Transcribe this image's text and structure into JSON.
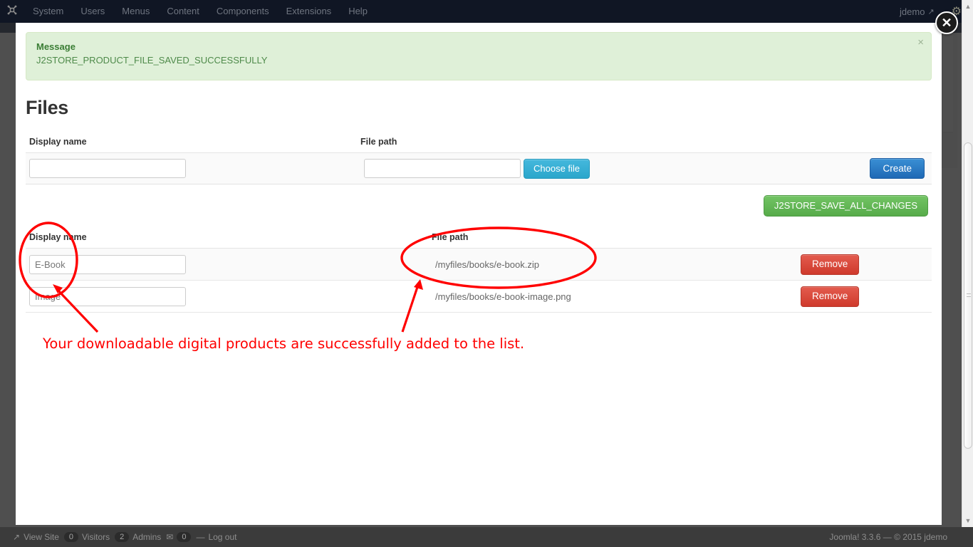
{
  "admin_bar": {
    "logo_icon": "joomla-logo-icon",
    "menu": [
      {
        "label": "System"
      },
      {
        "label": "Users"
      },
      {
        "label": "Menus"
      },
      {
        "label": "Content"
      },
      {
        "label": "Components"
      },
      {
        "label": "Extensions"
      },
      {
        "label": "Help"
      }
    ],
    "user": "jdemo",
    "external_link_icon": "external-link-icon",
    "gear_icon": "gear-icon"
  },
  "modal": {
    "close_icon": "close-icon",
    "close_label": "✕"
  },
  "alert": {
    "title": "Message",
    "text": "J2STORE_PRODUCT_FILE_SAVED_SUCCESSFULLY",
    "close_label": "×",
    "bg_color": "#dff0d8",
    "text_color": "#4e8a4a"
  },
  "page": {
    "title": "Files"
  },
  "create_form": {
    "headers": {
      "display_name": "Display name",
      "file_path": "File path"
    },
    "display_name_value": "",
    "display_name_placeholder": "",
    "file_path_value": "",
    "file_path_placeholder": "",
    "choose_file_label": "Choose file",
    "create_label": "Create"
  },
  "save_all": {
    "label": "J2STORE_SAVE_ALL_CHANGES",
    "color": "#5cb85c"
  },
  "file_list": {
    "headers": {
      "display_name": "Display name",
      "file_path": "File path"
    },
    "remove_label": "Remove",
    "rows": [
      {
        "display_name": "E-Book",
        "file_path": "/myfiles/books/e-book.zip",
        "remove_label": "Remove"
      },
      {
        "display_name": "Image",
        "file_path": "/myfiles/books/e-book-image.png",
        "remove_label": "Remove"
      }
    ]
  },
  "annotation": {
    "text": "Your downloadable digital products are successfully added to the list.",
    "color": "#ff0000"
  },
  "statusbar": {
    "view_site_icon": "external-link-icon",
    "view_site": "View Site",
    "visitors_count": "0",
    "visitors_label": "Visitors",
    "admins_count": "2",
    "admins_label": "Admins",
    "messages_icon": "envelope-icon",
    "messages_count": "0",
    "separator": "—",
    "logout": "Log out",
    "copyright": "Joomla! 3.3.6  —  © 2015 jdemo"
  },
  "scrollbar": {
    "up_arrow": "▲",
    "down_arrow": "▼"
  }
}
